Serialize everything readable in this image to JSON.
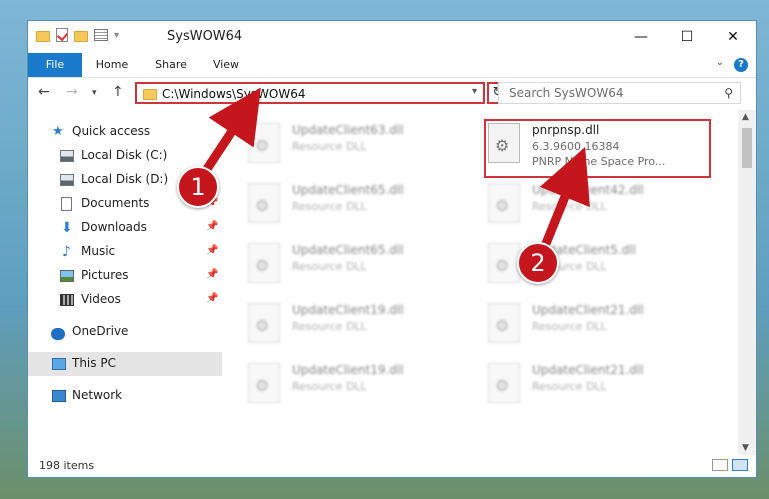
{
  "window": {
    "title": "SysWOW64",
    "minimize": "—",
    "maximize": "☐",
    "close": "✕"
  },
  "ribbon": {
    "tabs": [
      "File",
      "Home",
      "Share",
      "View"
    ],
    "help": "?"
  },
  "navigation": {
    "address": "C:\\Windows\\SysWOW64",
    "search_placeholder": "Search SysWOW64"
  },
  "sidebar": {
    "items": [
      {
        "label": "Quick access",
        "icon": "star-icon"
      },
      {
        "label": "Local Disk (C:)",
        "icon": "drive-icon"
      },
      {
        "label": "Local Disk (D:)",
        "icon": "drive-icon"
      },
      {
        "label": "Documents",
        "icon": "documents-icon"
      },
      {
        "label": "Downloads",
        "icon": "download-icon"
      },
      {
        "label": "Music",
        "icon": "music-icon"
      },
      {
        "label": "Pictures",
        "icon": "pictures-icon"
      },
      {
        "label": "Videos",
        "icon": "videos-icon"
      },
      {
        "label": "OneDrive",
        "icon": "cloud-icon"
      },
      {
        "label": "This PC",
        "icon": "pc-icon"
      },
      {
        "label": "Network",
        "icon": "network-icon"
      }
    ]
  },
  "files": {
    "left_column": [
      {
        "name": "UpdateClient63.dll",
        "type": "Resource DLL"
      },
      {
        "name": "UpdateClient65.dll",
        "type": "Resource DLL"
      },
      {
        "name": "UpdateClient65.dll",
        "type": "Resource DLL"
      },
      {
        "name": "UpdateClient19.dll",
        "type": "Resource DLL"
      },
      {
        "name": "UpdateClient19.dll",
        "type": "Resource DLL"
      }
    ],
    "highlighted": {
      "name": "pnrpnsp.dll",
      "version": "6.3.9600.16384",
      "description": "PNRP Name Space Pro..."
    },
    "right_column": [
      {
        "name": "UpdateClient42.dll",
        "type": "Resource DLL"
      },
      {
        "name": "UpdateClient5.dll",
        "type": "Resource DLL"
      },
      {
        "name": "UpdateClient21.dll",
        "type": "Resource DLL"
      },
      {
        "name": "UpdateClient21.dll",
        "type": "Resource DLL"
      }
    ]
  },
  "status": {
    "item_count": "198 items"
  },
  "callouts": [
    "1",
    "2"
  ],
  "colors": {
    "accent": "#1979ca",
    "highlight_red": "#d13438",
    "callout_red": "#c4161c"
  }
}
